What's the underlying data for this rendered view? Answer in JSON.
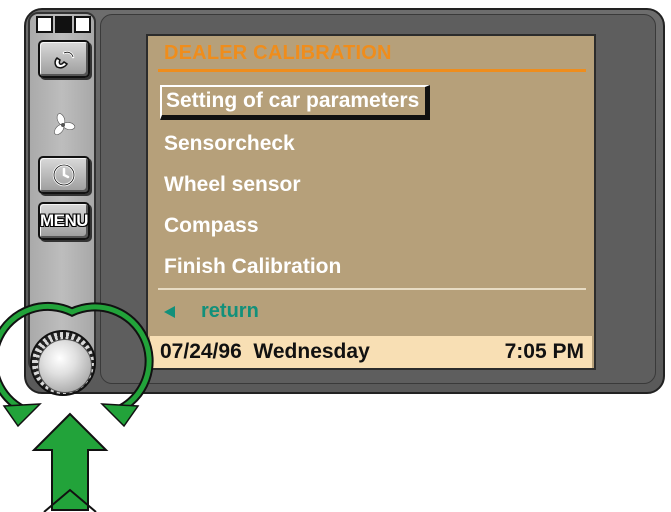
{
  "screen": {
    "title": "DEALER CALIBRATION",
    "menu_items": [
      {
        "label": "Setting of car parameters",
        "selected": true
      },
      {
        "label": "Sensorcheck",
        "selected": false
      },
      {
        "label": "Wheel sensor",
        "selected": false
      },
      {
        "label": "Compass",
        "selected": false
      },
      {
        "label": "Finish Calibration",
        "selected": false
      }
    ],
    "return_label": "return",
    "status": {
      "date": "07/24/96",
      "day": "Wednesday",
      "time": "7:05 PM"
    }
  },
  "controls": {
    "menu_button_label": "MENU",
    "indicator_squares": [
      "white",
      "black",
      "white"
    ],
    "buttons": [
      "phone-icon",
      "fan-icon",
      "clock-icon",
      "menu-button"
    ],
    "knob": "rotary-knob",
    "hints": [
      "rotate-arrows",
      "press-arrow"
    ]
  },
  "colors": {
    "screen_bg": "#b6a07a",
    "title": "#ef8d1c",
    "return": "#12907a",
    "status_bg": "#f8dfb4",
    "hint_arrow": "#22a33a"
  }
}
